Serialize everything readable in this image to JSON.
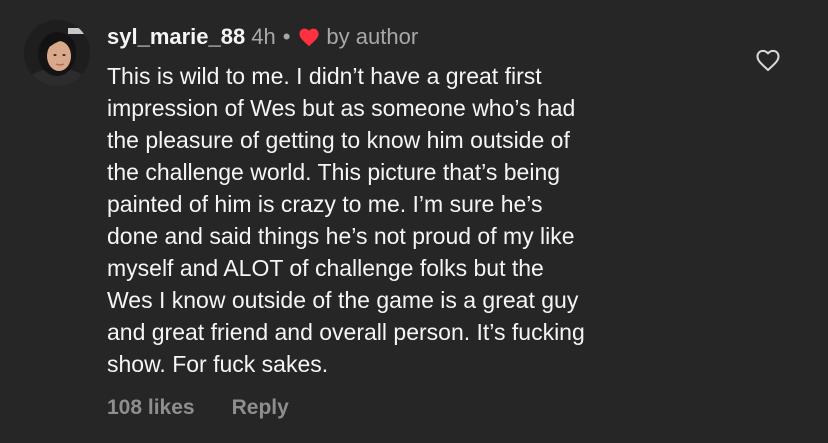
{
  "comment": {
    "username": "syl_marie_88",
    "timestamp": "4h",
    "separator": "•",
    "author_badge": "by author",
    "body_lines": [
      "This is wild to me. I didn’t have a great first",
      "impression of Wes but as someone who’s had",
      "the pleasure of getting to know him outside of",
      "the challenge world. This picture that’s being",
      "painted of him is crazy to me. I’m sure he’s",
      "done and said things he’s not proud of my like",
      "myself and ALOT of challenge folks but the",
      "Wes I know outside of the game is a great guy",
      "and great friend and overall person. It’s fucking",
      "show. For fuck sakes."
    ],
    "likes": "108 likes",
    "reply_label": "Reply",
    "icons": {
      "avatar": "user-avatar",
      "author_heart": "heart-filled-icon",
      "like_button": "heart-outline-icon"
    },
    "colors": {
      "background": "#262626",
      "author_heart": "#ff3040",
      "muted": "#a8a8a8"
    }
  }
}
